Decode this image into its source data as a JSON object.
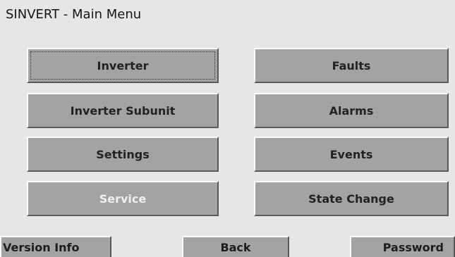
{
  "window": {
    "title": "SINVERT - Main Menu"
  },
  "menu": {
    "left": [
      {
        "label": "Inverter",
        "state": "focused"
      },
      {
        "label": "Inverter Subunit",
        "state": "normal"
      },
      {
        "label": "Settings",
        "state": "normal"
      },
      {
        "label": "Service",
        "state": "disabled"
      }
    ],
    "right": [
      {
        "label": "Faults",
        "state": "normal"
      },
      {
        "label": "Alarms",
        "state": "normal"
      },
      {
        "label": "Events",
        "state": "normal"
      },
      {
        "label": "State Change",
        "state": "normal"
      }
    ]
  },
  "footer": {
    "version_label": "Version Info",
    "back_label": "Back",
    "password_label": "Password"
  },
  "colors": {
    "background": "#e6e6e6",
    "button_face": "#a3a3a3",
    "button_highlight": "#fbfbfb",
    "button_shadow": "#5a5a5a",
    "disabled_text": "#efefef"
  }
}
